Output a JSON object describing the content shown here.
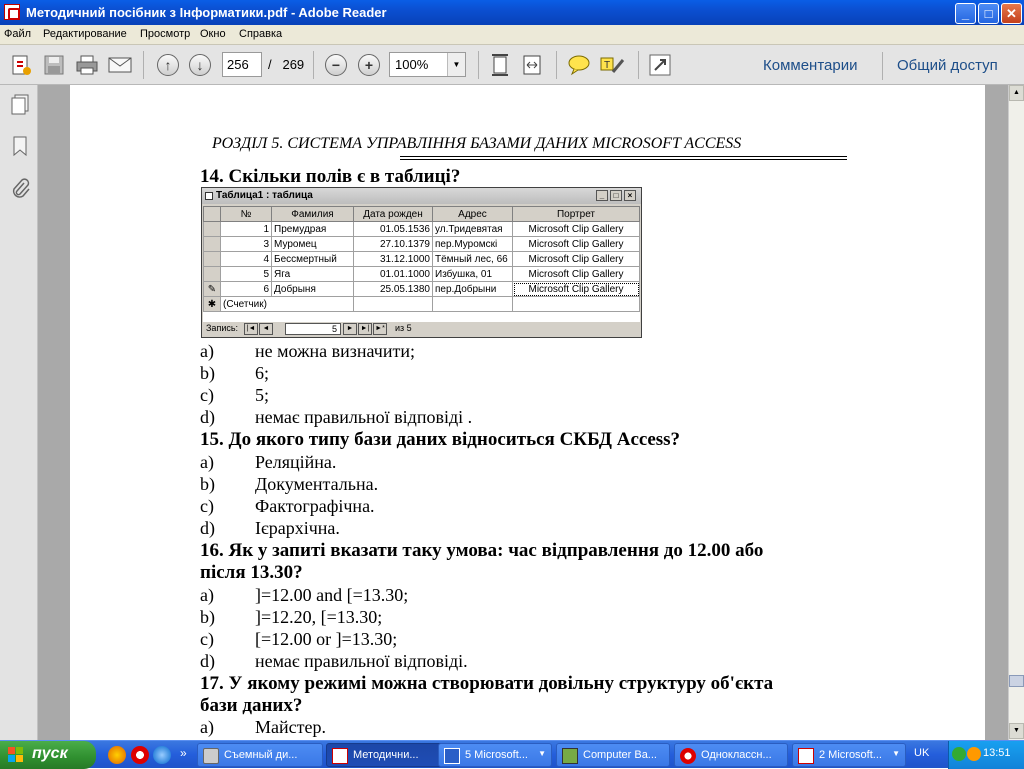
{
  "window": {
    "title": "Методичний посібник з Інформатики.pdf - Adobe Reader",
    "min": "_",
    "max": "□",
    "close": "✕"
  },
  "menu": [
    "Файл",
    "Редактирование",
    "Просмотр",
    "Окно",
    "Справка"
  ],
  "toolbar": {
    "page_current": "256",
    "page_sep": "/",
    "page_total": "269",
    "zoom": "100%",
    "comments": "Комментарии",
    "share": "Общий доступ",
    "minus": "−",
    "plus": "+"
  },
  "doc": {
    "header": "РОЗДІЛ 5. СИСТЕМА УПРАВЛІННЯ БАЗАМИ ДАНИХ MICROSOFT ACCESS",
    "q14": "14. Скільки полів є в таблиці?",
    "q14_opts": [
      {
        "l": "a)",
        "t": "не можна визначити;"
      },
      {
        "l": "b)",
        "t": "6;"
      },
      {
        "l": "c)",
        "t": "5;"
      },
      {
        "l": "d)",
        "t": "немає правильної відповіді ."
      }
    ],
    "q15": "15. До якого типу бази даних відноситься СКБД Access?",
    "q15_opts": [
      {
        "l": "a)",
        "t": "Реляційна."
      },
      {
        "l": "b)",
        "t": "Документальна."
      },
      {
        "l": "c)",
        "t": "Фактографічна."
      },
      {
        "l": "d)",
        "t": "Ієрархічна."
      }
    ],
    "q16_line1": "16. Як у запиті вказати таку умова: час відправлення до 12.00 або",
    "q16_line2": "після 13.30?",
    "q16_opts": [
      {
        "l": "a)",
        "t": "]=12.00 and [=13.30;"
      },
      {
        "l": "b)",
        "t": "]=12.20, [=13.30;"
      },
      {
        "l": "c)",
        "t": "[=12.00 or ]=13.30;"
      },
      {
        "l": "d)",
        "t": "немає правильної відповіді."
      }
    ],
    "q17_line1": "17. У якому режимі можна створювати довільну структуру об'єкта",
    "q17_line2": "бази даних?",
    "q17_opts": [
      {
        "l": "a)",
        "t": "Майстер."
      }
    ]
  },
  "access_table": {
    "caption": "Таблица1 : таблица",
    "columns": [
      "№",
      "Фамилия",
      "Дата рожден",
      "Адрес",
      "Портрет"
    ],
    "rows": [
      {
        "sel": "",
        "num": "1",
        "name": "Премудрая",
        "date": "01.05.1536",
        "addr": "ул.Тридевятая",
        "pic": "Microsoft Clip Gallery"
      },
      {
        "sel": "",
        "num": "3",
        "name": "Муромец",
        "date": "27.10.1379",
        "addr": "пер.Муромскі",
        "pic": "Microsoft Clip Gallery"
      },
      {
        "sel": "",
        "num": "4",
        "name": "Бессмертный",
        "date": "31.12.1000",
        "addr": "Тёмный лес, 66",
        "pic": "Microsoft Clip Gallery"
      },
      {
        "sel": "",
        "num": "5",
        "name": "Яга",
        "date": "01.01.1000",
        "addr": "Избушка, 01",
        "pic": "Microsoft Clip Gallery"
      },
      {
        "sel": "✎",
        "num": "6",
        "name": "Добрыня",
        "date": "25.05.1380",
        "addr": "пер.Добрыни",
        "pic": "Microsoft Clip Gallery"
      }
    ],
    "new_row": {
      "sel": "✱",
      "num": "(Счетчик)"
    },
    "record_label": "Запись:",
    "record_value": "5",
    "record_of": "из  5"
  },
  "taskbar": {
    "start": "пуск",
    "tasks": [
      {
        "label": "Съемный ди..."
      },
      {
        "label": "Методични..."
      },
      {
        "label": "5 Microsoft..."
      },
      {
        "label": "Computer Ba..."
      },
      {
        "label": "Одноклассн..."
      },
      {
        "label": "2 Microsoft..."
      }
    ],
    "lang": "UK",
    "clock": "13:51",
    "chevron": "»"
  }
}
